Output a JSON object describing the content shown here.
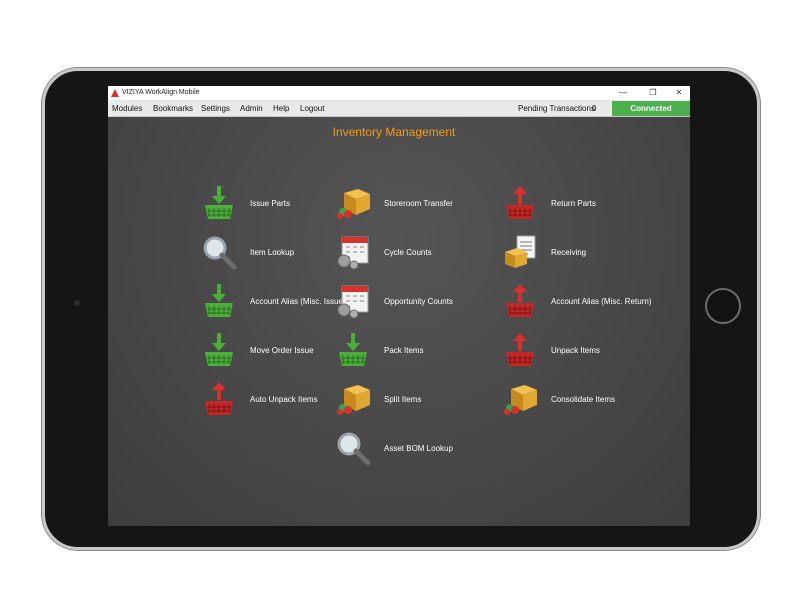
{
  "window": {
    "title": "VIZIYA WorkAlign Mobile",
    "minimize": "—",
    "restore": "❐",
    "close": "✕"
  },
  "menu": {
    "items": [
      "Modules",
      "Bookmarks",
      "Settings",
      "Admin",
      "Help",
      "Logout"
    ]
  },
  "status": {
    "pending_label": "Pending Transactions",
    "pending_count": "0",
    "connection": "Connected",
    "connection_color": "#4caf50"
  },
  "page": {
    "title": "Inventory Management",
    "title_color": "#f39c12"
  },
  "modules": [
    {
      "label": "Issue Parts",
      "icon": "basket-down-icon"
    },
    {
      "label": "Storeroom Transfer",
      "icon": "box-transfer-icon"
    },
    {
      "label": "Return Parts",
      "icon": "basket-up-icon"
    },
    {
      "label": "Item  Lookup",
      "icon": "magnifier-icon"
    },
    {
      "label": "Cycle Counts",
      "icon": "calendar-gears-icon"
    },
    {
      "label": "Receiving",
      "icon": "box-clipboard-icon"
    },
    {
      "label": "Account Alias (Misc. Issue)",
      "icon": "basket-down-icon"
    },
    {
      "label": "Opportunity Counts",
      "icon": "calendar-gears-icon"
    },
    {
      "label": "Account Alias (Misc. Return)",
      "icon": "basket-up-icon"
    },
    {
      "label": "Move Order Issue",
      "icon": "basket-down-icon"
    },
    {
      "label": "Pack Items",
      "icon": "basket-down-icon"
    },
    {
      "label": "Unpack Items",
      "icon": "basket-up-icon"
    },
    {
      "label": "Auto Unpack Items",
      "icon": "basket-up-icon"
    },
    {
      "label": "Split Items",
      "icon": "box-transfer-icon"
    },
    {
      "label": "Consolidate Items",
      "icon": "box-transfer-icon"
    },
    {
      "label": "Asset BOM Lookup",
      "icon": "magnifier-icon"
    }
  ]
}
